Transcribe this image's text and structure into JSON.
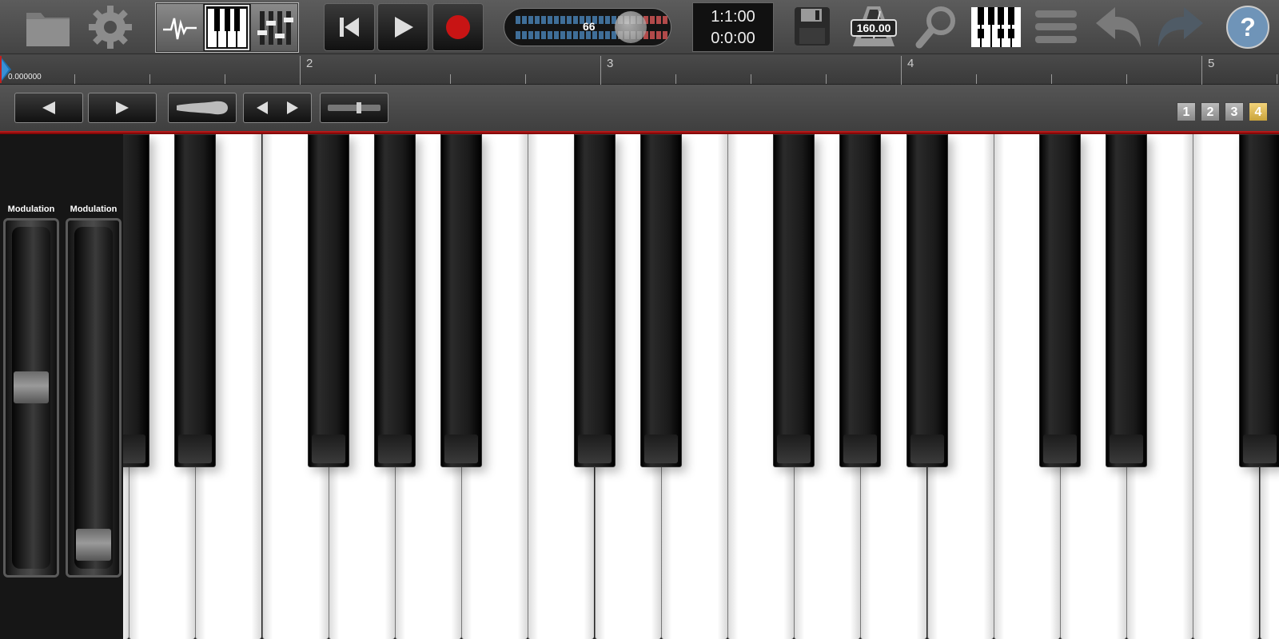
{
  "toolbar": {
    "volume": {
      "value": "66",
      "level": 0.66
    },
    "position": "1:1:00",
    "time": "0:0:00",
    "tempo": "160.00",
    "views": [
      "waveform-view",
      "keyboard-view",
      "mixer-view"
    ],
    "active_view": "keyboard-view"
  },
  "ruler": {
    "bars": [
      "2",
      "3",
      "4",
      "5"
    ],
    "position_label": "0.000000"
  },
  "page_tabs": [
    "1",
    "2",
    "3",
    "4"
  ],
  "active_page": "4",
  "wheels": [
    {
      "label": "Modulation",
      "level": 0.52
    },
    {
      "label": "Modulation",
      "level": 0.0
    }
  ],
  "colors": {
    "accent": "#c02020",
    "active_tab": "#e0bf5c",
    "meter_blue": "#3f6e98"
  }
}
